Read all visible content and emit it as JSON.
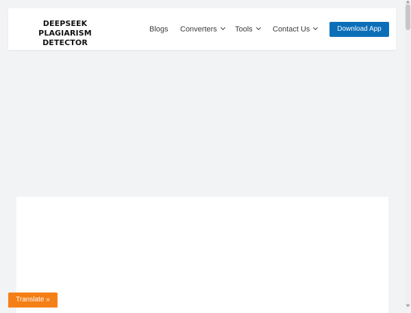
{
  "brand": {
    "line1": "DEEPSEEK PLAGIARISM",
    "line2": "DETECTOR"
  },
  "nav": {
    "blogs": "Blogs",
    "converters": "Converters",
    "tools": "Tools",
    "contact": "Contact Us"
  },
  "cta": {
    "download_label": "Download App"
  },
  "translate": {
    "label": "Translate »"
  },
  "colors": {
    "accent": "#0b6fb8",
    "translate": "#f57f17",
    "background": "#f2f3f5"
  },
  "icons": [
    "chevron-down-icon"
  ]
}
